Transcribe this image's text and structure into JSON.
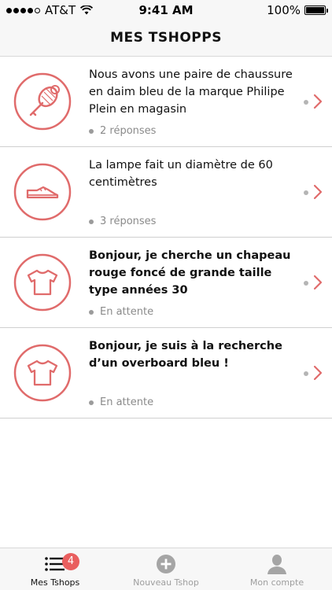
{
  "status_bar": {
    "carrier": "AT&T",
    "time": "9:41 AM",
    "battery": "100%",
    "signal_icon": "signal-dots-icon",
    "wifi_icon": "wifi-icon",
    "battery_icon": "battery-icon"
  },
  "nav": {
    "title": "MES TSHOPPS"
  },
  "colors": {
    "accent": "#e06b6b",
    "badge": "#e95f5f",
    "separator": "#cfcfcf",
    "muted": "#8a8a8a"
  },
  "requests": [
    {
      "icon": "tennis-racket-icon",
      "text": "Nous avons une paire de chaussure en daim bleu de la marque Philipe Plein en magasin",
      "status": "2 réponses",
      "bold": false
    },
    {
      "icon": "shoe-icon",
      "text": "La lampe fait un diamètre de 60 centimètres",
      "status": "3 réponses",
      "bold": false
    },
    {
      "icon": "tshirt-icon",
      "text": "Bonjour, je cherche un chapeau rouge foncé de grande taille type années 30",
      "status": "En attente",
      "bold": true
    },
    {
      "icon": "tshirt-icon",
      "text": "Bonjour, je suis à la recherche d’un overboard bleu !",
      "status": "En attente",
      "bold": true
    }
  ],
  "tabbar": {
    "tabs": [
      {
        "label": "Mes Tshops",
        "icon": "list-icon",
        "badge": "4",
        "active": true
      },
      {
        "label": "Nouveau Tshop",
        "icon": "plus-circle-icon",
        "active": false
      },
      {
        "label": "Mon compte",
        "icon": "user-icon",
        "active": false
      }
    ]
  }
}
